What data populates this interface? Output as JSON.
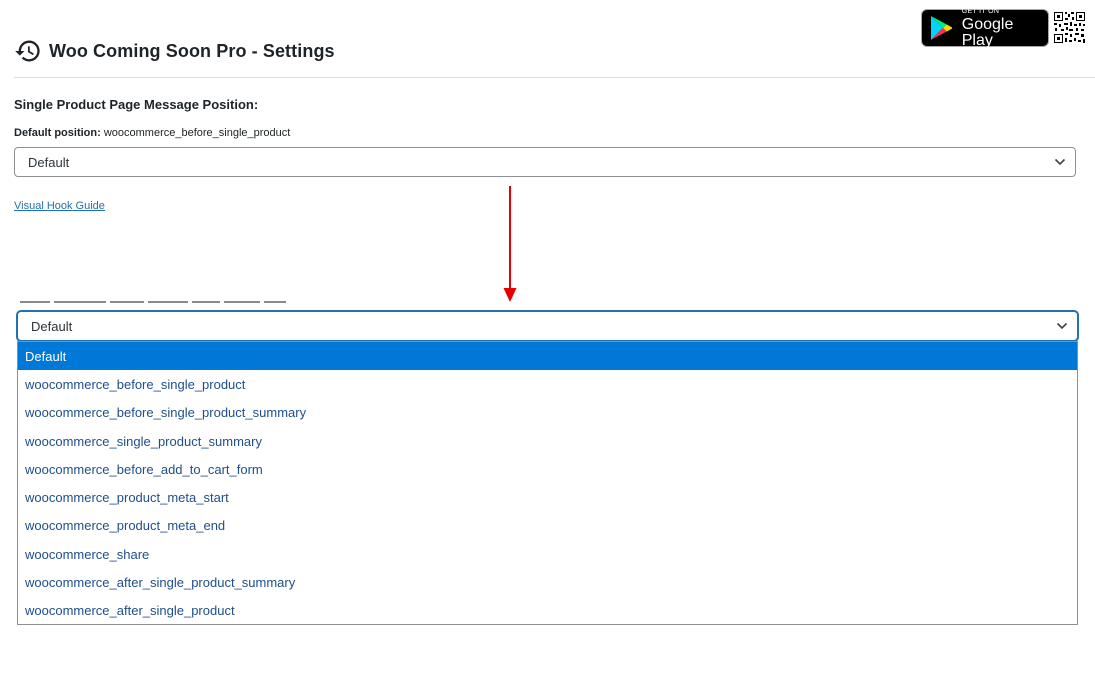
{
  "header": {
    "title": "Woo Coming Soon Pro - Settings"
  },
  "badge": {
    "small": "GET IT ON",
    "big": "Google Play"
  },
  "section": {
    "title": "Single Product Page Message Position:",
    "default_label": "Default position:",
    "default_value": "woocommerce_before_single_product"
  },
  "select_top": {
    "value": "Default"
  },
  "link": {
    "label": "Visual Hook Guide"
  },
  "select_open": {
    "value": "Default",
    "options": [
      "Default",
      "woocommerce_before_single_product",
      "woocommerce_before_single_product_summary",
      "woocommerce_single_product_summary",
      "woocommerce_before_add_to_cart_form",
      "woocommerce_product_meta_start",
      "woocommerce_product_meta_end",
      "woocommerce_share",
      "woocommerce_after_single_product_summary",
      "woocommerce_after_single_product"
    ],
    "selected_index": 0
  },
  "colors": {
    "accent": "#2271b1",
    "selected_bg": "#0078d7",
    "arrow": "#e60000"
  }
}
